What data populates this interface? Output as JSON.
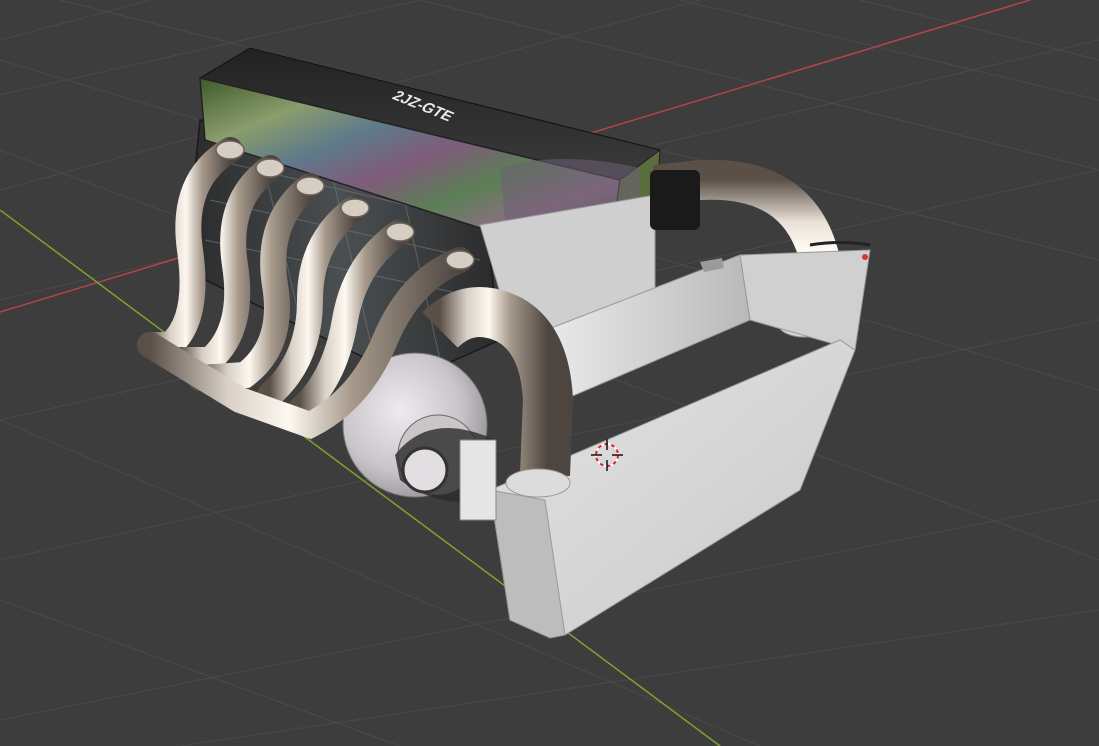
{
  "viewport": {
    "background_color": "#3d3d3d",
    "grid_color": "#4a4a4a",
    "x_axis_color": "#b5434c",
    "y_axis_color": "#7fa22c",
    "show_grid": true,
    "show_axes": true
  },
  "model": {
    "cover_text": "2JZ-GTE",
    "cover_text_color": "#eaeaea",
    "chrome_color": "#c8c0b8",
    "intercooler_color": "#d8d8d8",
    "turbo_color": "#d0cdd0"
  },
  "cursor": {
    "icon": "3d-cursor-icon",
    "ring_colors": [
      "#e22222",
      "#ffffff"
    ]
  }
}
